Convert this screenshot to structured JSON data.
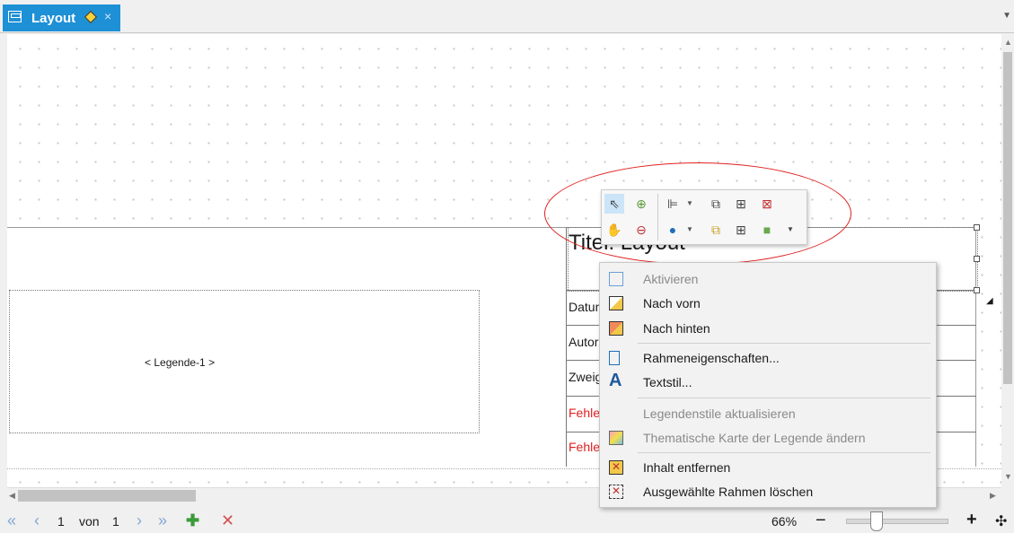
{
  "tab": {
    "title": "Layout",
    "close": "×"
  },
  "layout": {
    "title": "Titel: Layout",
    "legend_label": "< Legende-1 >",
    "rows": [
      "Datum",
      "Autor",
      "Zweig",
      "Fehler",
      "Fehler"
    ],
    "error_color": "#e02020"
  },
  "status": {
    "page_current": "1",
    "page_of": "von",
    "page_total": "1",
    "zoom": "66%",
    "zoom_fraction": 0.3
  },
  "mini_toolbar": {
    "tools": [
      {
        "name": "select-tool",
        "glyph": "⇖"
      },
      {
        "name": "zoom-in-tool",
        "glyph": "⊕"
      },
      {
        "name": "pan-tool",
        "glyph": "✋"
      },
      {
        "name": "zoom-out-tool",
        "glyph": "⊖"
      }
    ]
  },
  "context_menu": {
    "items": [
      {
        "label": "Aktivieren",
        "disabled": true
      },
      {
        "label": "Nach vorn",
        "disabled": false
      },
      {
        "label": "Nach hinten",
        "disabled": false
      },
      {
        "label": "Rahmeneigenschaften...",
        "disabled": false
      },
      {
        "label": "Textstil...",
        "disabled": false
      },
      {
        "label": "Legendenstile aktualisieren",
        "disabled": true
      },
      {
        "label": "Thematische Karte der Legende ändern",
        "disabled": true
      },
      {
        "label": "Inhalt entfernen",
        "disabled": false
      },
      {
        "label": "Ausgewählte Rahmen löschen",
        "disabled": false
      }
    ]
  },
  "colors": {
    "accent": "#1e90d6",
    "highlight_ellipse": "#e02020"
  }
}
